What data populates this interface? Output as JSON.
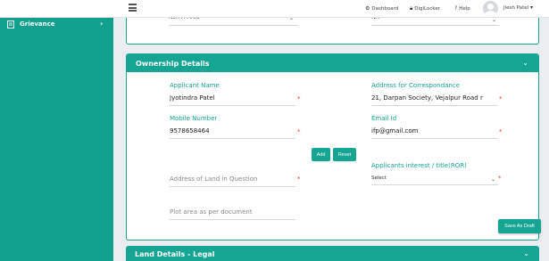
{
  "sidebar": {
    "items": [
      {
        "label": "Grievance",
        "icon": "document-icon",
        "chevron": "›"
      }
    ],
    "color": "#12a08e"
  },
  "header": {
    "links": [
      {
        "label": "Dashboard",
        "icon": "dashboard-icon"
      },
      {
        "label": "DigiLocker",
        "icon": "lock-icon"
      },
      {
        "label": "Help",
        "icon": "question-icon"
      }
    ],
    "user_name": "Jiesh Patel"
  },
  "previous_card": {
    "left_value": "Non Fi Area",
    "right_value": "NA"
  },
  "ownership": {
    "title": "Ownership Details",
    "applicant_name_label": "Applicant Name",
    "applicant_name_value": "Jyotindra Patel",
    "address_label": "Address for Correspondance",
    "address_value": "21, Darpan Society,  Vejalpur Road r",
    "mobile_label": "Mobile Number",
    "mobile_value": "9578658464",
    "email_label": "Email Id",
    "email_value": "ifp@gmail.com",
    "add_label": "Add",
    "reset_label": "Reset",
    "interest_label": "Applicants interest / title(ROR)",
    "interest_selected": "Select",
    "land_address_placeholder": "Address of Land in Question",
    "plot_area_placeholder": "Plot area as per document",
    "required_mark": "*",
    "save_draft_label": "Save As Draft"
  },
  "land_details": {
    "title": "Land Details - Legal"
  },
  "colors": {
    "accent": "#16a593",
    "required": "#e53935"
  }
}
